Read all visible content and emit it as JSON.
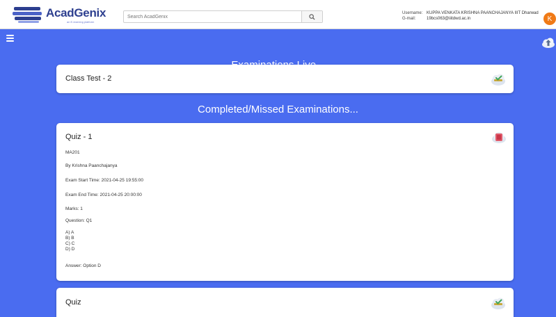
{
  "header": {
    "logo_name": "AcadGenix",
    "logo_tagline": "an E-learning platform",
    "search_placeholder": "Search AcadGenix",
    "username_label": "Username:",
    "username_value": "KUPPA VENKATA KRISHNA PAANCHAJANYA IIIT Dharwad",
    "gmail_label": "G-mail:",
    "gmail_value": "19bcs063@iiitdwd.ac.in",
    "avatar_letter": "K"
  },
  "live": {
    "title": "Examinations Live...",
    "exams": [
      {
        "name": "Class Test - 2",
        "icon": "exam-live-icon"
      }
    ]
  },
  "completed": {
    "title": "Completed/Missed Examinations...",
    "exams": [
      {
        "name": "Quiz - 1",
        "icon": "exam-missed-icon",
        "course": "MA201",
        "author": "By Krishna Paanchajanya",
        "start": "Exam Start Time: 2021-04-25 19:55:00",
        "end": "Exam End Time: 2021-04-25 20:00:00",
        "marks": "Marks: 1",
        "question": "Question: Q1",
        "options": [
          "A) A",
          "B) B",
          "C) C",
          "D) D"
        ],
        "answer": "Answer: Option D"
      },
      {
        "name": "Quiz",
        "icon": "exam-live-icon"
      }
    ]
  },
  "colors": {
    "background": "#4a6cf0",
    "brand": "#2d3f8f",
    "avatar": "#f07a16"
  }
}
